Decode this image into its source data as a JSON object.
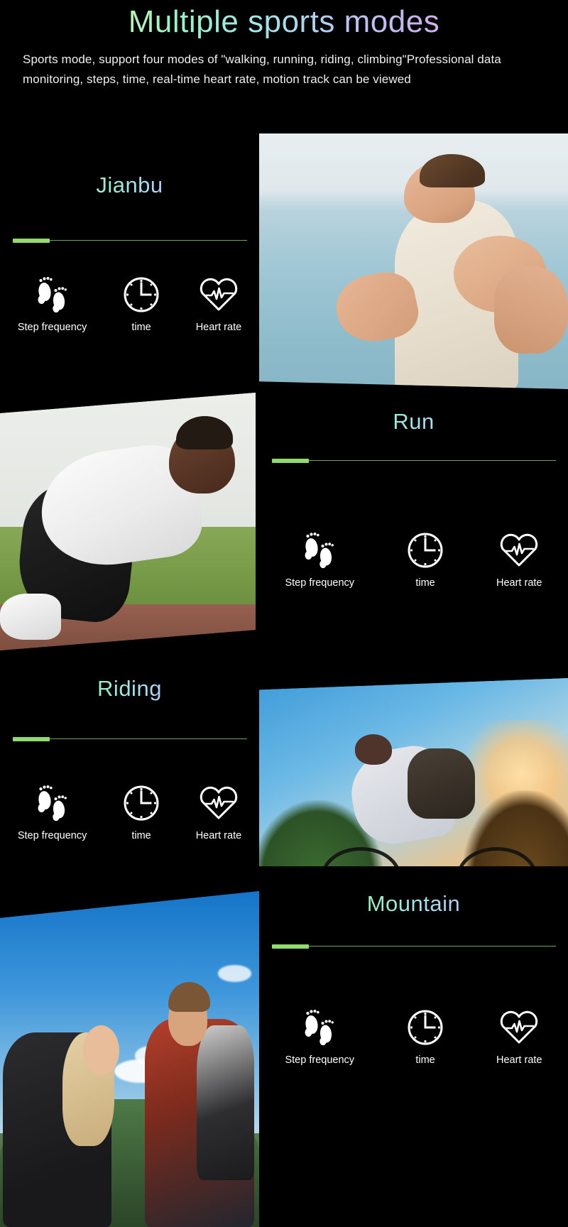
{
  "header": {
    "title": "Multiple sports modes",
    "description": "Sports mode, support four modes of \"walking, running, riding, climbing\"Professional data monitoring, steps, time, real-time heart rate, motion track can be viewed"
  },
  "colors": {
    "background": "#000000",
    "accent_bar": "#92d96e",
    "accent_line": "#6ea55a",
    "icon": "#ffffff",
    "body_text": "#efefef",
    "title_gradient_start": "#f6f3a8",
    "title_gradient_mid": "#9ef0c6",
    "title_gradient_end": "#f5a9c8"
  },
  "metrics": [
    {
      "icon": "footprints-icon",
      "label": "Step frequency"
    },
    {
      "icon": "clock-icon",
      "label": "time"
    },
    {
      "icon": "heart-rate-icon",
      "label": "Heart rate"
    }
  ],
  "sections": [
    {
      "id": "jianbu",
      "title": "Jianbu",
      "panel_side": "left",
      "photo_side": "right",
      "photo_alt": "Man jogging by the sea in a white tank top",
      "metrics": [
        {
          "icon": "footprints-icon",
          "label": "Step frequency"
        },
        {
          "icon": "clock-icon",
          "label": "time"
        },
        {
          "icon": "heart-rate-icon",
          "label": "Heart rate"
        }
      ]
    },
    {
      "id": "run",
      "title": "Run",
      "panel_side": "right",
      "photo_side": "left",
      "photo_alt": "Sprinter crouched at the starting blocks on a running track",
      "metrics": [
        {
          "icon": "footprints-icon",
          "label": "Step frequency"
        },
        {
          "icon": "clock-icon",
          "label": "time"
        },
        {
          "icon": "heart-rate-icon",
          "label": "Heart rate"
        }
      ]
    },
    {
      "id": "riding",
      "title": "Riding",
      "panel_side": "left",
      "photo_side": "right",
      "photo_alt": "Cyclist riding a mountain bike at sunset",
      "metrics": [
        {
          "icon": "footprints-icon",
          "label": "Step frequency"
        },
        {
          "icon": "clock-icon",
          "label": "time"
        },
        {
          "icon": "heart-rate-icon",
          "label": "Heart rate"
        }
      ]
    },
    {
      "id": "mountain",
      "title": "Mountain",
      "panel_side": "right",
      "photo_side": "left",
      "photo_alt": "Two hikers with backpacks holding hands on a mountain ridge",
      "metrics": [
        {
          "icon": "footprints-icon",
          "label": "Step frequency"
        },
        {
          "icon": "clock-icon",
          "label": "time"
        },
        {
          "icon": "heart-rate-icon",
          "label": "Heart rate"
        }
      ]
    }
  ]
}
